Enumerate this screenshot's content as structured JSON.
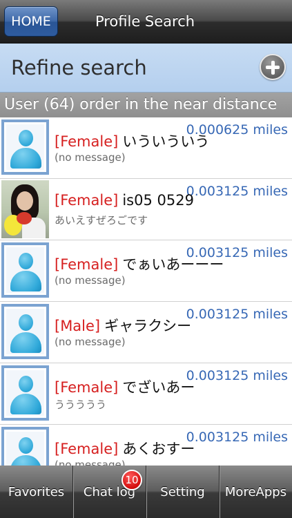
{
  "navbar": {
    "home_label": "HOME",
    "title": "Profile Search"
  },
  "refine": {
    "label": "Refine search",
    "add_icon": "plus-circle-icon"
  },
  "section_header": "User (64) order in the near distance",
  "users": [
    {
      "gender": "[Female]",
      "name": "いういういう",
      "message": "(no message)",
      "distance": "0.000625 miles",
      "avatar": "default-avatar-icon"
    },
    {
      "gender": "[Female]",
      "name": "is05 0529",
      "message": "あいえすぜろごです",
      "distance": "0.003125 miles",
      "avatar": "user-photo"
    },
    {
      "gender": "[Female]",
      "name": "でぁいあーーー",
      "message": "(no message)",
      "distance": "0.003125 miles",
      "avatar": "default-avatar-icon"
    },
    {
      "gender": "[Male]",
      "name": "ギャラクシー",
      "message": "(no message)",
      "distance": "0.003125 miles",
      "avatar": "default-avatar-icon"
    },
    {
      "gender": "[Female]",
      "name": "でざいあー",
      "message": "ううううう",
      "distance": "0.003125 miles",
      "avatar": "default-avatar-icon"
    },
    {
      "gender": "[Female]",
      "name": "あくおすー",
      "message": "(no message)",
      "distance": "0.003125 miles",
      "avatar": "default-avatar-icon"
    }
  ],
  "tabs": [
    {
      "label": "Favorites"
    },
    {
      "label": "Chat log",
      "badge": "10"
    },
    {
      "label": "Setting"
    },
    {
      "label": "MoreApps"
    }
  ],
  "colors": {
    "gender_text": "#d61f1f",
    "distance_text": "#3768b5",
    "avatar_border": "#7ba3d1"
  }
}
